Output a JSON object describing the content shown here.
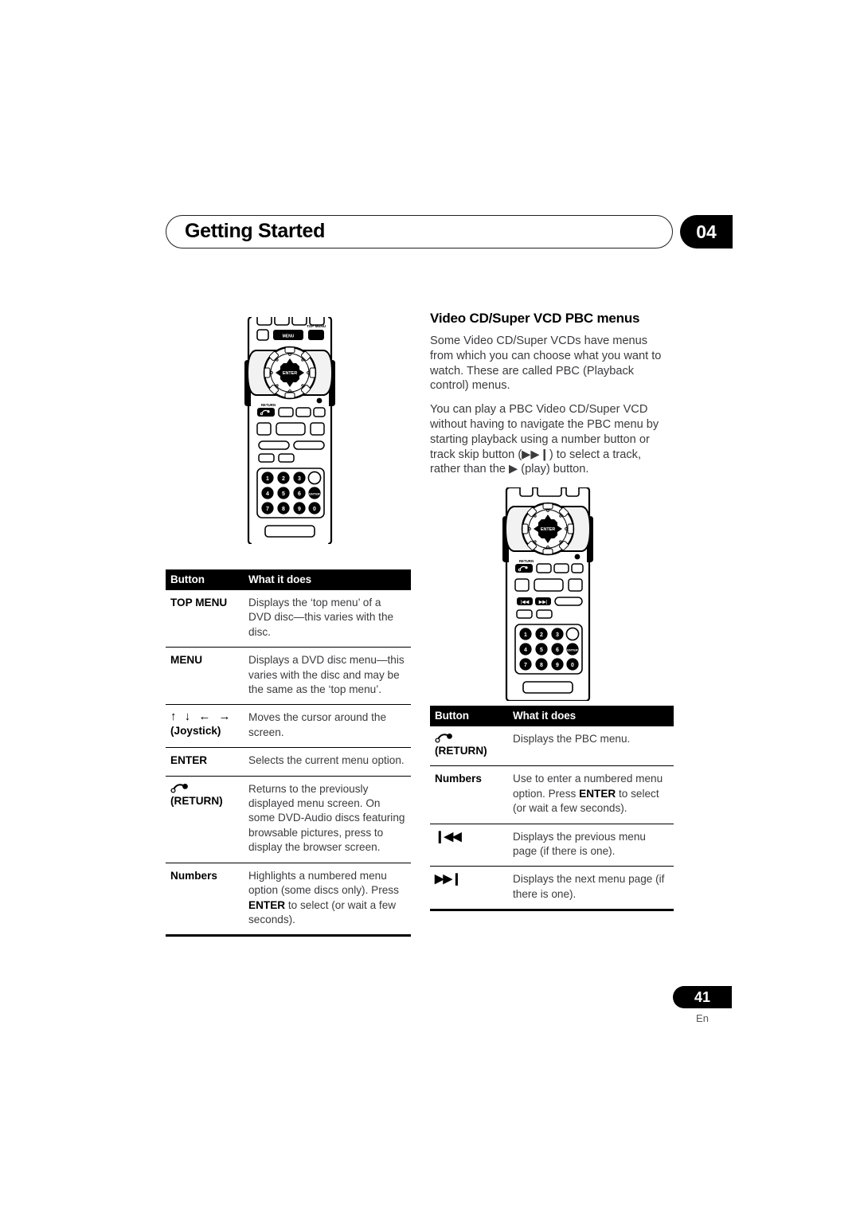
{
  "header": {
    "title": "Getting Started",
    "chapter": "04"
  },
  "left_column": {
    "remote_illustration": {
      "name": "remote-control-dvd-menu",
      "labels": [
        "MENU",
        "TOP MENU",
        "ENTER",
        "RETURN"
      ],
      "keypad": [
        "1",
        "2",
        "3",
        "4",
        "5",
        "6",
        "7",
        "8",
        "9",
        "0",
        "ENTER"
      ]
    },
    "table": {
      "headers": [
        "Button",
        "What it does"
      ],
      "rows": [
        {
          "button": "TOP MENU",
          "button_type": "text",
          "description": "Displays the ‘top menu’ of a DVD disc—this varies with the disc."
        },
        {
          "button": "MENU",
          "button_type": "text",
          "description": "Displays a DVD disc menu—this varies with the disc and may be the same as the ‘top menu’."
        },
        {
          "button": "(Joystick)",
          "button_type": "joystick",
          "glyphs": "↑ ↓ ← →",
          "description": "Moves the cursor around the screen."
        },
        {
          "button": "ENTER",
          "button_type": "text",
          "description": "Selects the current menu option."
        },
        {
          "button": "(RETURN)",
          "button_type": "return",
          "description": "Returns to the previously displayed menu screen. On some DVD-Audio discs featuring browsable pictures, press to display the browser screen."
        },
        {
          "button": "Numbers",
          "button_type": "text",
          "description_parts": [
            {
              "text": "Highlights a numbered menu option (some discs only). Press ",
              "bold": false
            },
            {
              "text": "ENTER",
              "bold": true
            },
            {
              "text": " to select (or wait a few seconds).",
              "bold": false
            }
          ]
        }
      ]
    }
  },
  "right_column": {
    "section_title": "Video CD/Super VCD PBC menus",
    "paragraphs": [
      "Some Video CD/Super VCDs have menus from which you can choose what you want to watch. These are called PBC (Playback control) menus.",
      "You can play a PBC Video CD/Super VCD without having to navigate the PBC menu by starting playback using a number button or track skip button (▶▶❙) to select a track, rather than the ▶ (play) button."
    ],
    "remote_illustration": {
      "name": "remote-control-pbc-menu",
      "labels": [
        "ENTER",
        "RETURN"
      ],
      "keypad": [
        "1",
        "2",
        "3",
        "4",
        "5",
        "6",
        "7",
        "8",
        "9",
        "0",
        "ENTER"
      ]
    },
    "table": {
      "headers": [
        "Button",
        "What it does"
      ],
      "rows": [
        {
          "button": "(RETURN)",
          "button_type": "return",
          "description": "Displays the PBC menu."
        },
        {
          "button": "Numbers",
          "button_type": "text",
          "description_parts": [
            {
              "text": "Use to enter a numbered menu option. Press ",
              "bold": false
            },
            {
              "text": "ENTER",
              "bold": true
            },
            {
              "text": " to select (or wait a few seconds).",
              "bold": false
            }
          ]
        },
        {
          "button": "❙◀◀",
          "button_type": "skip-back",
          "description": "Displays the previous menu page (if there is one)."
        },
        {
          "button": "▶▶❙",
          "button_type": "skip-forward",
          "description": "Displays the next menu page (if there is one)."
        }
      ]
    }
  },
  "footer": {
    "page_number": "41",
    "language_code": "En"
  },
  "colors": {
    "ink": "#231f20",
    "body_text": "#3b3b3e",
    "accent_black": "#000000",
    "paper": "#ffffff"
  }
}
